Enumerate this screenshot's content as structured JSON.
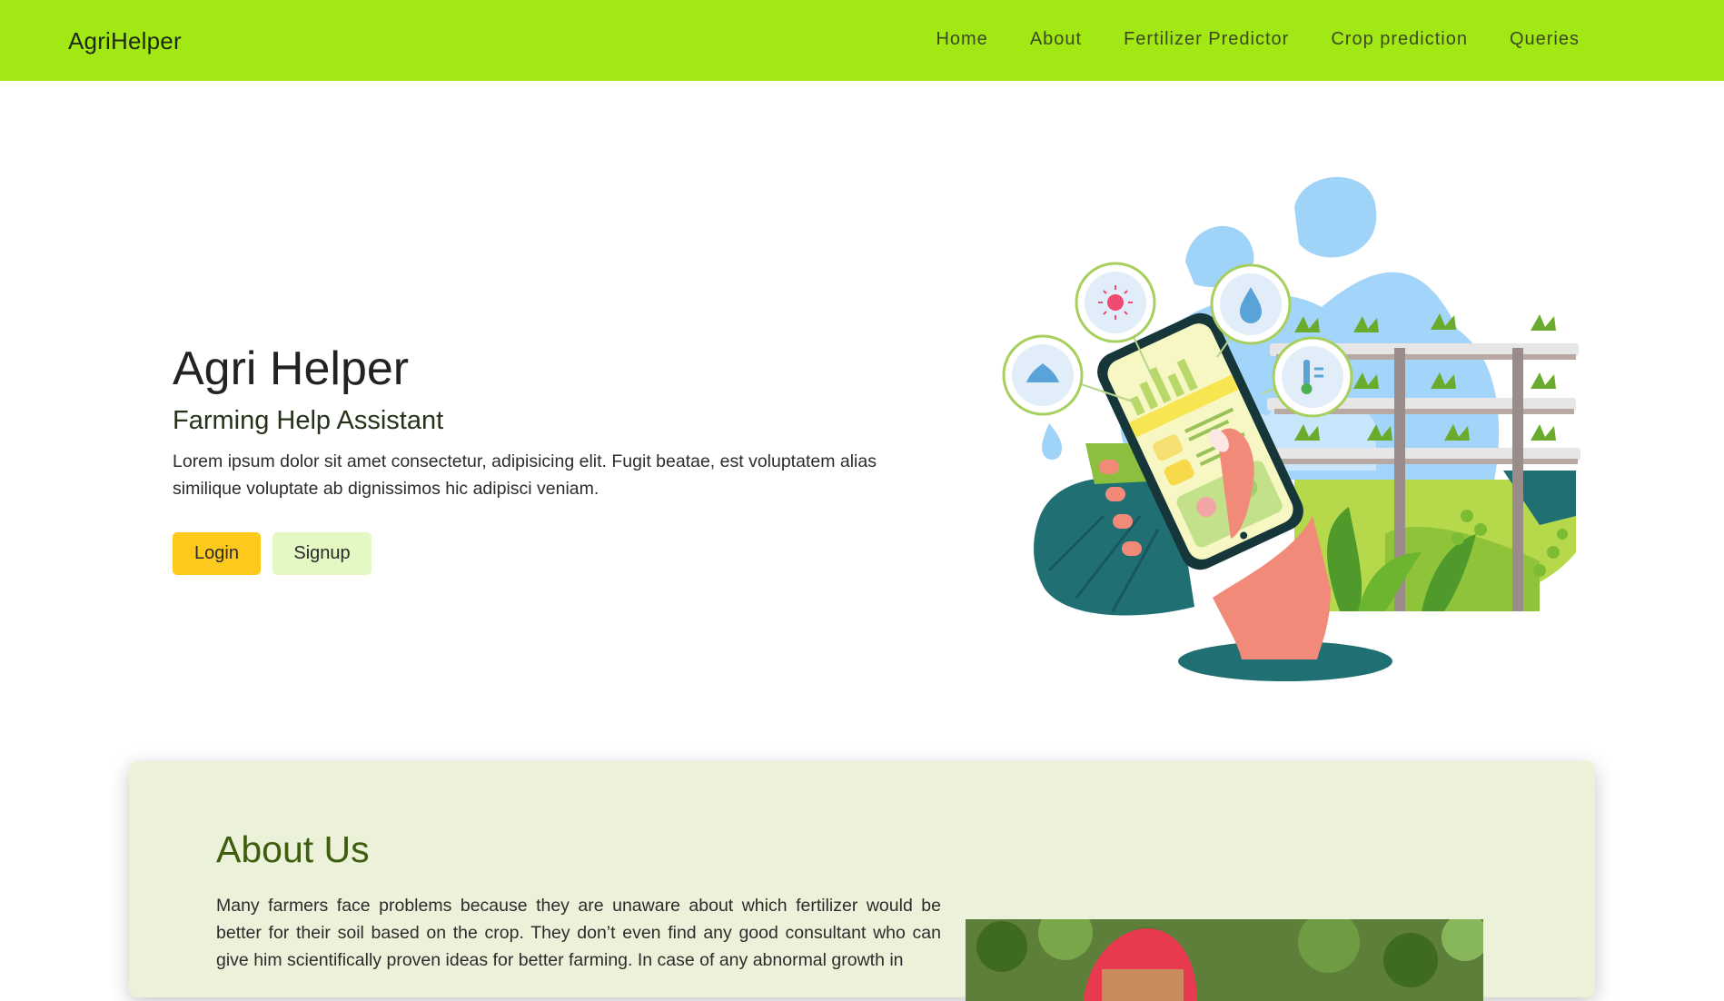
{
  "navbar": {
    "brand": "AgriHelper",
    "links": [
      "Home",
      "About",
      "Fertilizer Predictor",
      "Crop prediction",
      "Queries"
    ],
    "background_color": "#a1e815"
  },
  "hero": {
    "title": "Agri Helper",
    "subtitle": "Farming Help Assistant",
    "description": "Lorem ipsum dolor sit amet consectetur, adipisicing elit. Fugit beatae, est voluptatem alias similique voluptate ab dignissimos hic adipisci veniam.",
    "login_label": "Login",
    "signup_label": "Signup",
    "login_color": "#fec91d",
    "signup_color": "#e3f8c2"
  },
  "about": {
    "title": "About Us",
    "text": "Many farmers face problems because they are unaware about which fertilizer would be better for their soil based on the crop. They don’t even find any good consultant who can give him scientifically proven ideas for better farming. In case of any abnormal growth in",
    "card_color": "#ebf2d9",
    "title_color": "#3e5d0f"
  }
}
